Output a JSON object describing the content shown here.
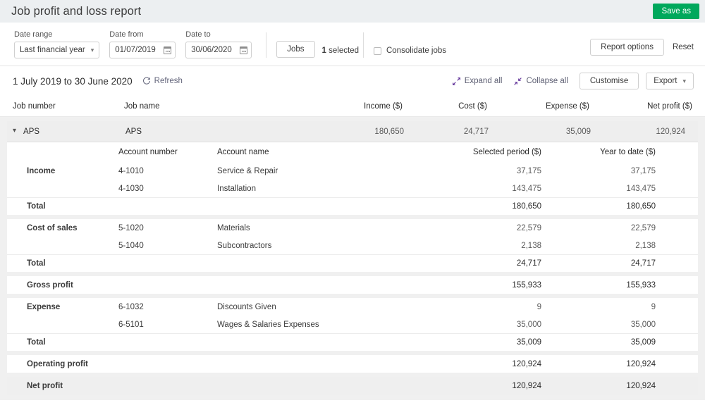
{
  "header": {
    "title": "Job profit and loss report",
    "save_as_label": "Save as",
    "save_as_color": "#00a85c"
  },
  "filters": {
    "date_range": {
      "label": "Date range",
      "value": "Last financial year"
    },
    "date_from": {
      "label": "Date from",
      "value": "01/07/2019"
    },
    "date_to": {
      "label": "Date to",
      "value": "30/06/2020"
    },
    "jobs_button": "Jobs",
    "jobs_selected_count": "1",
    "jobs_selected_text": "selected",
    "consolidate_jobs": {
      "label": "Consolidate jobs",
      "checked": false
    },
    "report_options": "Report options",
    "reset": "Reset"
  },
  "report": {
    "range_title": "1 July 2019 to 30 June 2020",
    "refresh": "Refresh",
    "expand_all": "Expand all",
    "collapse_all": "Collapse all",
    "customise": "Customise",
    "export": "Export"
  },
  "table": {
    "headers": {
      "job_number": "Job number",
      "job_name": "Job name",
      "income": "Income ($)",
      "cost": "Cost ($)",
      "expense": "Expense ($)",
      "net_profit": "Net profit ($)"
    },
    "job_row": {
      "job_number": "APS",
      "job_name": "APS",
      "income": "180,650",
      "cost": "24,717",
      "expense": "35,009",
      "net_profit": "120,924",
      "expanded": true
    },
    "sub_headers": {
      "account_number": "Account number",
      "account_name": "Account name",
      "selected_period": "Selected period ($)",
      "year_to_date": "Year to date ($)"
    },
    "sections": [
      {
        "label": "Income",
        "rows": [
          {
            "account_number": "4-1010",
            "account_name": "Service & Repair",
            "selected_period": "37,175",
            "year_to_date": "37,175"
          },
          {
            "account_number": "4-1030",
            "account_name": "Installation",
            "selected_period": "143,475",
            "year_to_date": "143,475"
          }
        ],
        "total": {
          "label": "Total",
          "selected_period": "180,650",
          "year_to_date": "180,650"
        }
      },
      {
        "label": "Cost of sales",
        "rows": [
          {
            "account_number": "5-1020",
            "account_name": "Materials",
            "selected_period": "22,579",
            "year_to_date": "22,579"
          },
          {
            "account_number": "5-1040",
            "account_name": "Subcontractors",
            "selected_period": "2,138",
            "year_to_date": "2,138"
          }
        ],
        "total": {
          "label": "Total",
          "selected_period": "24,717",
          "year_to_date": "24,717"
        }
      }
    ],
    "gross_profit": {
      "label": "Gross profit",
      "selected_period": "155,933",
      "year_to_date": "155,933"
    },
    "expense_section": {
      "label": "Expense",
      "rows": [
        {
          "account_number": "6-1032",
          "account_name": "Discounts Given",
          "selected_period": "9",
          "year_to_date": "9"
        },
        {
          "account_number": "6-5101",
          "account_name": "Wages & Salaries Expenses",
          "selected_period": "35,000",
          "year_to_date": "35,000"
        }
      ],
      "total": {
        "label": "Total",
        "selected_period": "35,009",
        "year_to_date": "35,009"
      }
    },
    "operating_profit": {
      "label": "Operating profit",
      "selected_period": "120,924",
      "year_to_date": "120,924"
    },
    "net_profit": {
      "label": "Net profit",
      "selected_period": "120,924",
      "year_to_date": "120,924"
    }
  }
}
